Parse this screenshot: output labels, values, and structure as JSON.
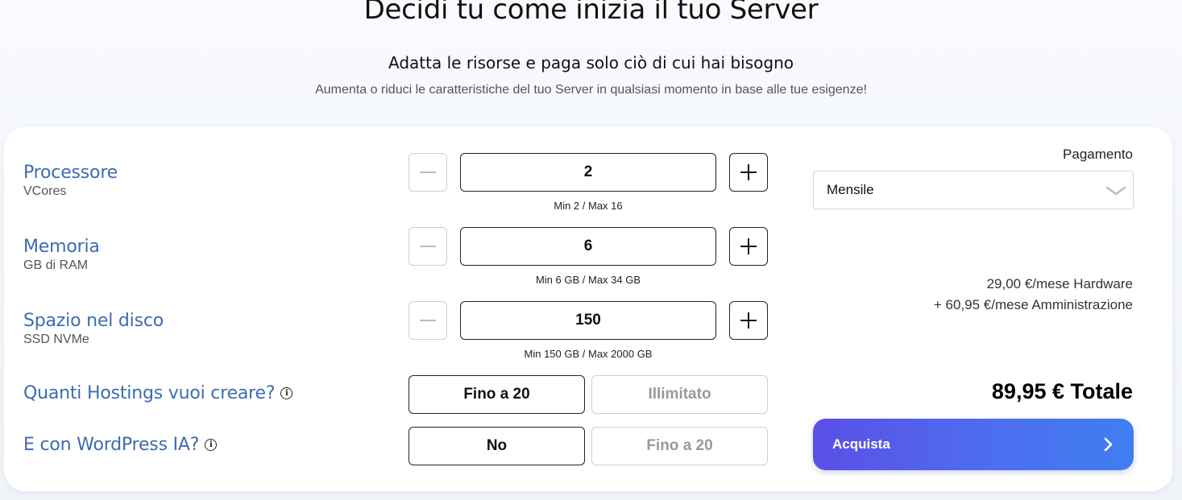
{
  "hero": {
    "title": "Decidi tu come inizia il tuo Server",
    "subtitle": "Adatta le risorse e paga solo ciò di cui hai bisogno",
    "description": "Aumenta o riduci le caratteristiche del tuo Server in qualsiasi momento in base alle tue esigenze!"
  },
  "resources": {
    "cpu": {
      "label": "Processore",
      "unit": "VCores",
      "value": "2",
      "range": "Min 2 / Max 16"
    },
    "ram": {
      "label": "Memoria",
      "unit": "GB di RAM",
      "value": "6",
      "range": "Min 6 GB / Max 34 GB"
    },
    "disk": {
      "label": "Spazio nel disco",
      "unit": "SSD NVMe",
      "value": "150",
      "range": "Min 150 GB / Max 2000 GB"
    }
  },
  "hostings": {
    "label": "Quanti Hostings vuoi creare?",
    "options": [
      "Fino a 20",
      "Illimitato"
    ],
    "selected": "Fino a 20"
  },
  "wordpress": {
    "label": "E con WordPress IA?",
    "options": [
      "No",
      "Fino a 20"
    ],
    "selected": "No"
  },
  "payment": {
    "label": "Pagamento",
    "selected": "Mensile",
    "hardware": "29,00 €/mese Hardware",
    "admin": "+ 60,95 €/mese Amministrazione",
    "total": "89,95 € Totale",
    "buy_label": "Acquista"
  },
  "colors": {
    "label_blue": "#3e6bb0",
    "button_gradient_start": "#5b4fe6",
    "button_gradient_end": "#3f7ef1"
  },
  "icons": {
    "minus": "minus-icon",
    "plus": "plus-icon",
    "info": "info-icon",
    "dropdown": "chevron-down-icon",
    "arrow": "chevron-right-icon"
  }
}
